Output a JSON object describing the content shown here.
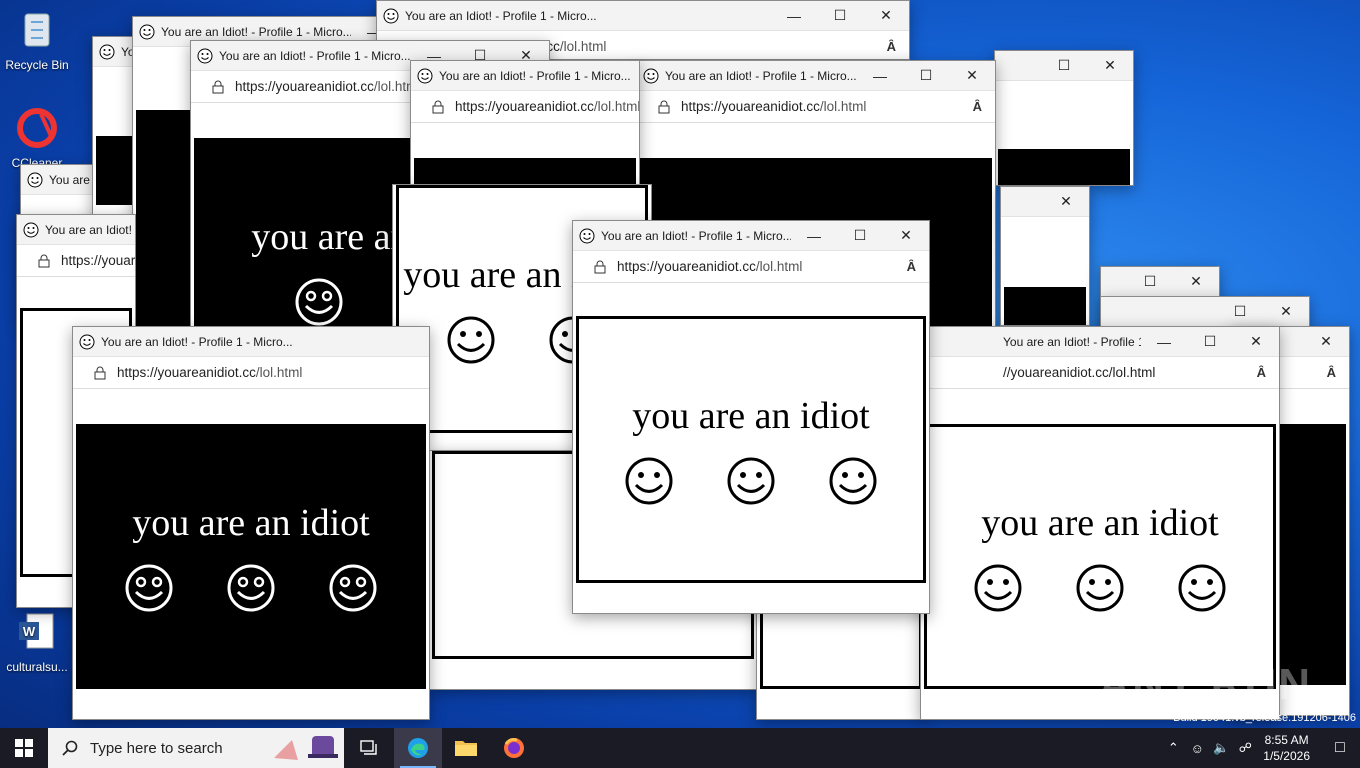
{
  "desktop": {
    "icons": [
      {
        "label": "Recycle Bin",
        "icon": "recycle-bin-icon"
      },
      {
        "label": "CCleaner",
        "icon": "ccleaner-icon"
      },
      {
        "label": "culturalsu...",
        "icon": "word-document-icon"
      }
    ]
  },
  "popup": {
    "title": "You are an Idiot! - Profile 1 - Micro...",
    "title_short": "You are an Idiot!",
    "url_host": "https://youareanidiot.cc",
    "url_path": "/lol.html",
    "url_partial": "//youareanidiot.cc/lol.html",
    "message": "you are an idiot",
    "read_aloud": "Ȃ"
  },
  "taskbar": {
    "search_placeholder": "Type here to search",
    "time": "8:55 AM",
    "date": "1/5/2026",
    "apps": [
      "task-view",
      "edge",
      "file-explorer",
      "firefox"
    ]
  },
  "watermark": "ANY RUN",
  "build_text": "Build 19041.vb_release.191206-1406",
  "colors": {
    "accent": "#0078d4",
    "taskbar": "#1b1b26",
    "page_dark": "#000000",
    "page_light": "#ffffff"
  }
}
